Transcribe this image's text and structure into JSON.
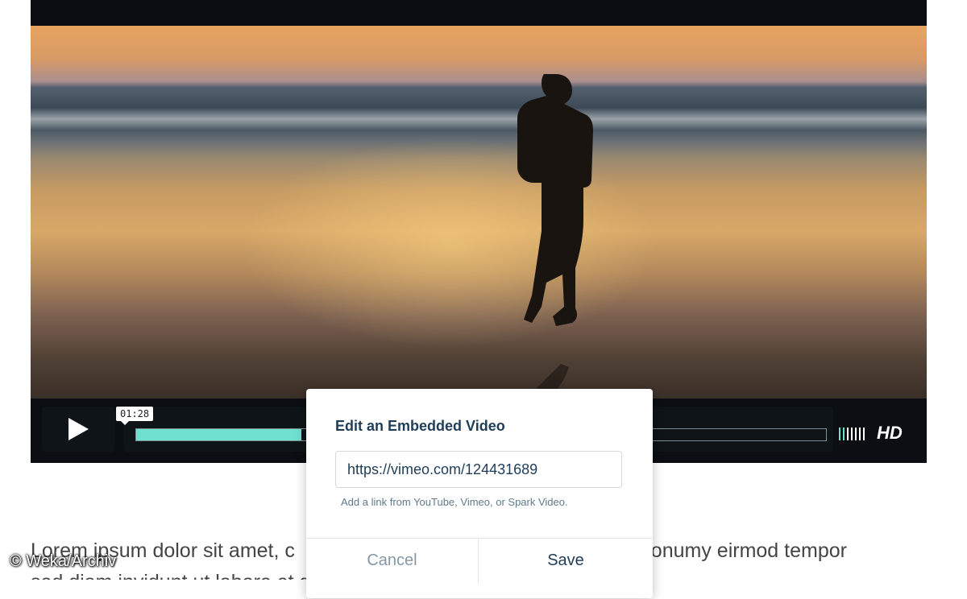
{
  "player": {
    "current_time": "01:28",
    "progress": 0.24,
    "volume_bars_on": 2,
    "volume_bars_total": 7,
    "quality_badge": "HD",
    "accent_color": "#6fe0d0"
  },
  "modal": {
    "title": "Edit an Embedded Video",
    "url_value": "https://vimeo.com/124431689",
    "hint": "Add a link from YouTube, Vimeo, or Spark Video.",
    "cancel_label": "Cancel",
    "save_label": "Save"
  },
  "body_text": {
    "line1_left": "Lorem ipsum dolor sit amet, c",
    "line1_right": "nonumy eirmod tempor",
    "line2": "sed diam invidunt ut labore et dolore magna aliquyam erat sed diam"
  },
  "watermark": "© Weka/Archiv",
  "icons": {
    "play": "play-icon",
    "volume": "volume-bars-icon"
  }
}
